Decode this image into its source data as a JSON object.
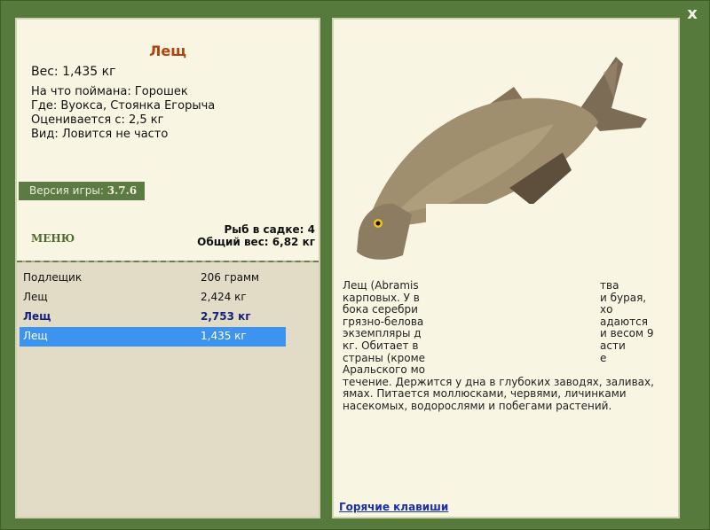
{
  "close_label": "x",
  "fish": {
    "name": "Лещ",
    "weight": "Вес: 1,435 кг",
    "bait": "На что поймана: Горошек",
    "location": "Где: Вуокса, Стоянка Егорыча",
    "value": "Оценивается с: 2,5 кг",
    "rarity": "Вид: Ловится не часто"
  },
  "version": {
    "label": "Версия игры:",
    "value": "3.7.6"
  },
  "menu_label": "МЕНЮ",
  "keepnet": {
    "count": "Рыб в садке: 4",
    "total": "Общий вес: 6,82 кг"
  },
  "catch_list": [
    {
      "name": "Подлещик",
      "weight": "206 грамм"
    },
    {
      "name": "Лещ",
      "weight": "2,424 кг"
    },
    {
      "name": "Лещ",
      "weight": "2,753 кг"
    },
    {
      "name": "Лещ",
      "weight": "1,435 кг"
    }
  ],
  "description": [
    "Лещ (Abramis",
    "карповых. У в",
    "бока серебри",
    "грязно-белова",
    "экземпляры д",
    "кг. Обитает в",
    "страны (кроме",
    "Аральского мо",
    "течение. Держится у дна в глубоких заводях, заливах,",
    "ямах. Питается моллюсками, червями, личинками",
    "насекомых, водорослями и побегами растений."
  ],
  "description_right": [
    "тва",
    "и бурая,",
    "хо",
    "адаются",
    "и весом 9",
    "асти",
    "е"
  ],
  "hotkeys_label": "Горячие клавиши",
  "colors": {
    "frame": "#567a3b",
    "panel_bg": "#f8f6e2",
    "name_color": "#b3420f",
    "selected_row": "#3d93f0",
    "bold_row": "#142080"
  }
}
